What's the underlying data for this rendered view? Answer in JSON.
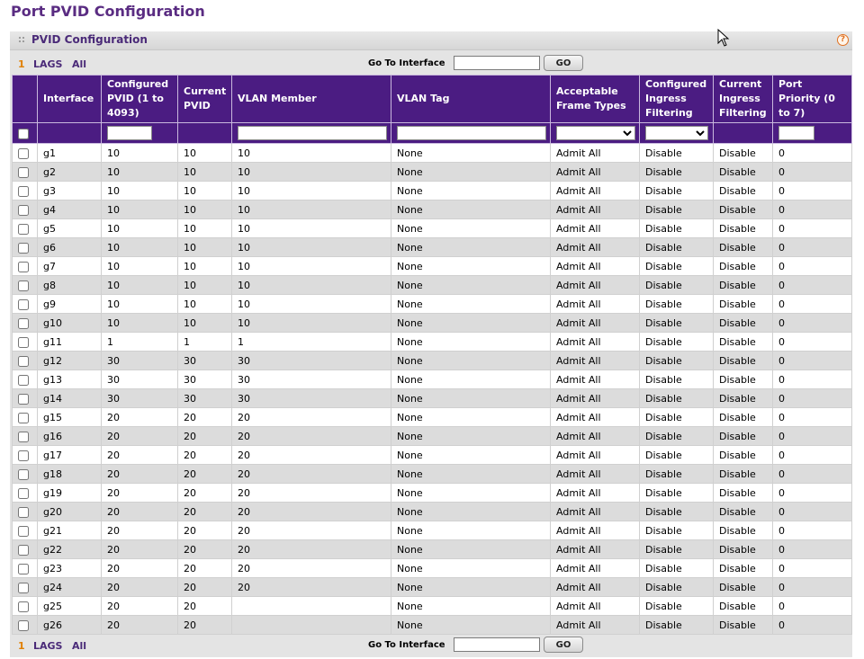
{
  "page": {
    "title": "Port PVID Configuration"
  },
  "panel": {
    "title": "PVID Configuration",
    "help_icon": "?"
  },
  "pager": {
    "page_number": "1",
    "lags_label": "LAGS",
    "all_label": "All",
    "goto_label": "Go To Interface",
    "goto_value": "",
    "go_button": "GO"
  },
  "table": {
    "headers": {
      "interface": "Interface",
      "configured_pvid": "Configured PVID (1 to 4093)",
      "current_pvid": "Current PVID",
      "vlan_member": "VLAN Member",
      "vlan_tag": "VLAN Tag",
      "acceptable_frame_types": "Acceptable Frame Types",
      "configured_ingress_filtering": "Configured Ingress Filtering",
      "current_ingress_filtering": "Current Ingress Filtering",
      "port_priority": "Port Priority (0 to 7)"
    },
    "filter": {
      "configured_pvid": "",
      "vlan_member": "",
      "vlan_tag": "",
      "acceptable_frame_types": "",
      "configured_ingress_filtering": "",
      "port_priority": ""
    },
    "rows": [
      {
        "interface": "g1",
        "configured_pvid": "10",
        "current_pvid": "10",
        "vlan_member": "10",
        "vlan_tag": "None",
        "frame_types": "Admit All",
        "cfg_ingress": "Disable",
        "cur_ingress": "Disable",
        "priority": "0"
      },
      {
        "interface": "g2",
        "configured_pvid": "10",
        "current_pvid": "10",
        "vlan_member": "10",
        "vlan_tag": "None",
        "frame_types": "Admit All",
        "cfg_ingress": "Disable",
        "cur_ingress": "Disable",
        "priority": "0"
      },
      {
        "interface": "g3",
        "configured_pvid": "10",
        "current_pvid": "10",
        "vlan_member": "10",
        "vlan_tag": "None",
        "frame_types": "Admit All",
        "cfg_ingress": "Disable",
        "cur_ingress": "Disable",
        "priority": "0"
      },
      {
        "interface": "g4",
        "configured_pvid": "10",
        "current_pvid": "10",
        "vlan_member": "10",
        "vlan_tag": "None",
        "frame_types": "Admit All",
        "cfg_ingress": "Disable",
        "cur_ingress": "Disable",
        "priority": "0"
      },
      {
        "interface": "g5",
        "configured_pvid": "10",
        "current_pvid": "10",
        "vlan_member": "10",
        "vlan_tag": "None",
        "frame_types": "Admit All",
        "cfg_ingress": "Disable",
        "cur_ingress": "Disable",
        "priority": "0"
      },
      {
        "interface": "g6",
        "configured_pvid": "10",
        "current_pvid": "10",
        "vlan_member": "10",
        "vlan_tag": "None",
        "frame_types": "Admit All",
        "cfg_ingress": "Disable",
        "cur_ingress": "Disable",
        "priority": "0"
      },
      {
        "interface": "g7",
        "configured_pvid": "10",
        "current_pvid": "10",
        "vlan_member": "10",
        "vlan_tag": "None",
        "frame_types": "Admit All",
        "cfg_ingress": "Disable",
        "cur_ingress": "Disable",
        "priority": "0"
      },
      {
        "interface": "g8",
        "configured_pvid": "10",
        "current_pvid": "10",
        "vlan_member": "10",
        "vlan_tag": "None",
        "frame_types": "Admit All",
        "cfg_ingress": "Disable",
        "cur_ingress": "Disable",
        "priority": "0"
      },
      {
        "interface": "g9",
        "configured_pvid": "10",
        "current_pvid": "10",
        "vlan_member": "10",
        "vlan_tag": "None",
        "frame_types": "Admit All",
        "cfg_ingress": "Disable",
        "cur_ingress": "Disable",
        "priority": "0"
      },
      {
        "interface": "g10",
        "configured_pvid": "10",
        "current_pvid": "10",
        "vlan_member": "10",
        "vlan_tag": "None",
        "frame_types": "Admit All",
        "cfg_ingress": "Disable",
        "cur_ingress": "Disable",
        "priority": "0"
      },
      {
        "interface": "g11",
        "configured_pvid": "1",
        "current_pvid": "1",
        "vlan_member": "1",
        "vlan_tag": "None",
        "frame_types": "Admit All",
        "cfg_ingress": "Disable",
        "cur_ingress": "Disable",
        "priority": "0"
      },
      {
        "interface": "g12",
        "configured_pvid": "30",
        "current_pvid": "30",
        "vlan_member": "30",
        "vlan_tag": "None",
        "frame_types": "Admit All",
        "cfg_ingress": "Disable",
        "cur_ingress": "Disable",
        "priority": "0"
      },
      {
        "interface": "g13",
        "configured_pvid": "30",
        "current_pvid": "30",
        "vlan_member": "30",
        "vlan_tag": "None",
        "frame_types": "Admit All",
        "cfg_ingress": "Disable",
        "cur_ingress": "Disable",
        "priority": "0"
      },
      {
        "interface": "g14",
        "configured_pvid": "30",
        "current_pvid": "30",
        "vlan_member": "30",
        "vlan_tag": "None",
        "frame_types": "Admit All",
        "cfg_ingress": "Disable",
        "cur_ingress": "Disable",
        "priority": "0"
      },
      {
        "interface": "g15",
        "configured_pvid": "20",
        "current_pvid": "20",
        "vlan_member": "20",
        "vlan_tag": "None",
        "frame_types": "Admit All",
        "cfg_ingress": "Disable",
        "cur_ingress": "Disable",
        "priority": "0"
      },
      {
        "interface": "g16",
        "configured_pvid": "20",
        "current_pvid": "20",
        "vlan_member": "20",
        "vlan_tag": "None",
        "frame_types": "Admit All",
        "cfg_ingress": "Disable",
        "cur_ingress": "Disable",
        "priority": "0"
      },
      {
        "interface": "g17",
        "configured_pvid": "20",
        "current_pvid": "20",
        "vlan_member": "20",
        "vlan_tag": "None",
        "frame_types": "Admit All",
        "cfg_ingress": "Disable",
        "cur_ingress": "Disable",
        "priority": "0"
      },
      {
        "interface": "g18",
        "configured_pvid": "20",
        "current_pvid": "20",
        "vlan_member": "20",
        "vlan_tag": "None",
        "frame_types": "Admit All",
        "cfg_ingress": "Disable",
        "cur_ingress": "Disable",
        "priority": "0"
      },
      {
        "interface": "g19",
        "configured_pvid": "20",
        "current_pvid": "20",
        "vlan_member": "20",
        "vlan_tag": "None",
        "frame_types": "Admit All",
        "cfg_ingress": "Disable",
        "cur_ingress": "Disable",
        "priority": "0"
      },
      {
        "interface": "g20",
        "configured_pvid": "20",
        "current_pvid": "20",
        "vlan_member": "20",
        "vlan_tag": "None",
        "frame_types": "Admit All",
        "cfg_ingress": "Disable",
        "cur_ingress": "Disable",
        "priority": "0"
      },
      {
        "interface": "g21",
        "configured_pvid": "20",
        "current_pvid": "20",
        "vlan_member": "20",
        "vlan_tag": "None",
        "frame_types": "Admit All",
        "cfg_ingress": "Disable",
        "cur_ingress": "Disable",
        "priority": "0"
      },
      {
        "interface": "g22",
        "configured_pvid": "20",
        "current_pvid": "20",
        "vlan_member": "20",
        "vlan_tag": "None",
        "frame_types": "Admit All",
        "cfg_ingress": "Disable",
        "cur_ingress": "Disable",
        "priority": "0"
      },
      {
        "interface": "g23",
        "configured_pvid": "20",
        "current_pvid": "20",
        "vlan_member": "20",
        "vlan_tag": "None",
        "frame_types": "Admit All",
        "cfg_ingress": "Disable",
        "cur_ingress": "Disable",
        "priority": "0"
      },
      {
        "interface": "g24",
        "configured_pvid": "20",
        "current_pvid": "20",
        "vlan_member": "20",
        "vlan_tag": "None",
        "frame_types": "Admit All",
        "cfg_ingress": "Disable",
        "cur_ingress": "Disable",
        "priority": "0"
      },
      {
        "interface": "g25",
        "configured_pvid": "20",
        "current_pvid": "20",
        "vlan_member": "",
        "vlan_tag": "None",
        "frame_types": "Admit All",
        "cfg_ingress": "Disable",
        "cur_ingress": "Disable",
        "priority": "0"
      },
      {
        "interface": "g26",
        "configured_pvid": "20",
        "current_pvid": "20",
        "vlan_member": "",
        "vlan_tag": "None",
        "frame_types": "Admit All",
        "cfg_ingress": "Disable",
        "cur_ingress": "Disable",
        "priority": "0"
      }
    ]
  },
  "colors": {
    "title": "#5a2c82",
    "header_bg": "#4b1c82",
    "pager_number": "#e08000",
    "row_alt": "#dcdcdc",
    "panel_bg": "#e4e4e4"
  },
  "icons": {
    "help": "help-icon",
    "grip": "grip-icon",
    "cursor": "mouse-pointer-icon"
  }
}
